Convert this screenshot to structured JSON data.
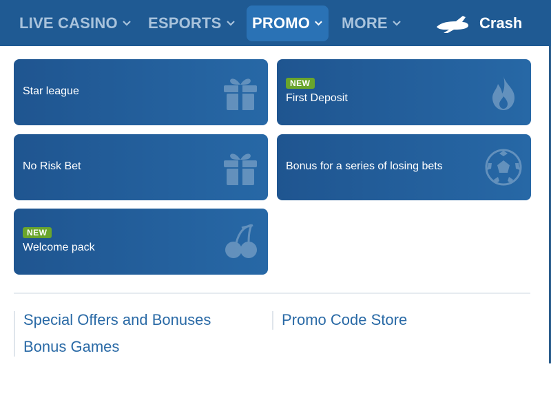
{
  "nav": {
    "items": [
      {
        "label": "LIVE CASINO",
        "icon": "chevron-down-icon"
      },
      {
        "label": "ESPORTS",
        "icon": "chevron-down-icon"
      },
      {
        "label": "PROMO",
        "icon": "chevron-down-icon",
        "active": true
      },
      {
        "label": "MORE",
        "icon": "chevron-down-icon"
      }
    ],
    "crash": {
      "label": "Crash",
      "icon": "plane-icon"
    }
  },
  "promo": {
    "cards": [
      {
        "label": "Star league",
        "icon": "gift-icon"
      },
      {
        "label": "First Deposit",
        "badge": "NEW",
        "icon": "flame-icon"
      },
      {
        "label": "No Risk Bet",
        "icon": "gift-icon"
      },
      {
        "label": "Bonus for a series of losing bets",
        "icon": "soccer-ball-icon"
      },
      {
        "label": "Welcome pack",
        "badge": "NEW",
        "icon": "cherries-icon"
      }
    ],
    "links": {
      "left": [
        "Special Offers and Bonuses",
        "Bonus Games"
      ],
      "right": [
        "Promo Code Store"
      ]
    }
  },
  "colors": {
    "topbar": "#1f5a93",
    "active_tab": "#2a72b5",
    "card_gradient_start": "#1f5590",
    "card_gradient_end": "#2768a6",
    "badge_green": "#6aa52c",
    "link_blue": "#2a6aa6"
  }
}
